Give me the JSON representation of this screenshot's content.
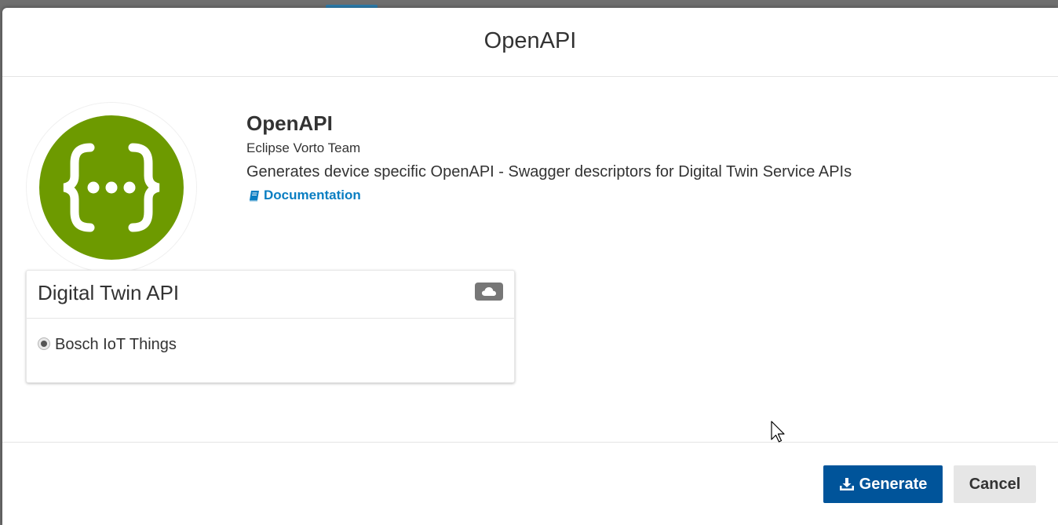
{
  "modal": {
    "title": "OpenAPI"
  },
  "generator": {
    "name": "OpenAPI",
    "author": "Eclipse Vorto Team",
    "description": "Generates device specific OpenAPI - Swagger descriptors for Digital Twin Service APIs",
    "documentation_label": "Documentation",
    "logo_icon": "swagger-braces-icon",
    "logo_color": "#6d9a00"
  },
  "panel": {
    "title": "Digital Twin API",
    "badge_icon": "cloud-icon",
    "options": [
      {
        "label": "Bosch IoT Things",
        "selected": true
      }
    ]
  },
  "footer": {
    "generate_label": "Generate",
    "generate_icon": "download-icon",
    "cancel_label": "Cancel"
  },
  "colors": {
    "primary": "#00549a",
    "link": "#0a7ec2"
  }
}
